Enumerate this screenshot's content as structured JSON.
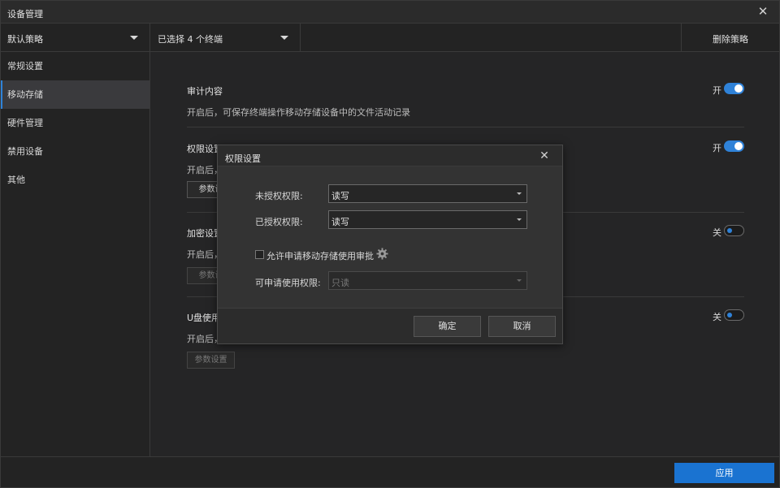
{
  "window": {
    "title": "设备管理",
    "close_icon": "close-icon"
  },
  "toolbar": {
    "policy": "默认策略",
    "terminals": "已选择 4 个终端",
    "delete_label": "删除策略"
  },
  "sidebar": {
    "items": [
      {
        "label": "常规设置",
        "active": false
      },
      {
        "label": "移动存储",
        "active": true
      },
      {
        "label": "硬件管理",
        "active": false
      },
      {
        "label": "禁用设备",
        "active": false
      },
      {
        "label": "其他",
        "active": false
      }
    ]
  },
  "main": {
    "sections": [
      {
        "title": "审计内容",
        "desc": "开启后，可保存终端操作移动存储设备中的文件活动记录",
        "toggle_text": "开",
        "on": true
      },
      {
        "title": "权限设置",
        "desc": "开启后，",
        "toggle_text": "开",
        "on": true,
        "param_label": "参数设"
      },
      {
        "title": "加密设置",
        "desc": "开启后，",
        "toggle_text": "关",
        "on": false,
        "param_label": "参数设"
      },
      {
        "title": "U盘使用",
        "desc": "开启后，",
        "toggle_text": "关",
        "on": false,
        "param_label": "参数设置"
      }
    ]
  },
  "footer": {
    "apply_label": "应用"
  },
  "dialog": {
    "title": "权限设置",
    "unauth_label": "未授权权限:",
    "unauth_value": "读写",
    "auth_label": "已授权权限:",
    "auth_value": "读写",
    "allow_label": "允许申请移动存储使用审批",
    "apply_label": "可申请使用权限:",
    "apply_value": "只读",
    "ok_label": "确定",
    "cancel_label": "取消"
  },
  "colors": {
    "accent": "#1a73d1",
    "toggle_on": "#2f82d8",
    "background": "#252526"
  }
}
